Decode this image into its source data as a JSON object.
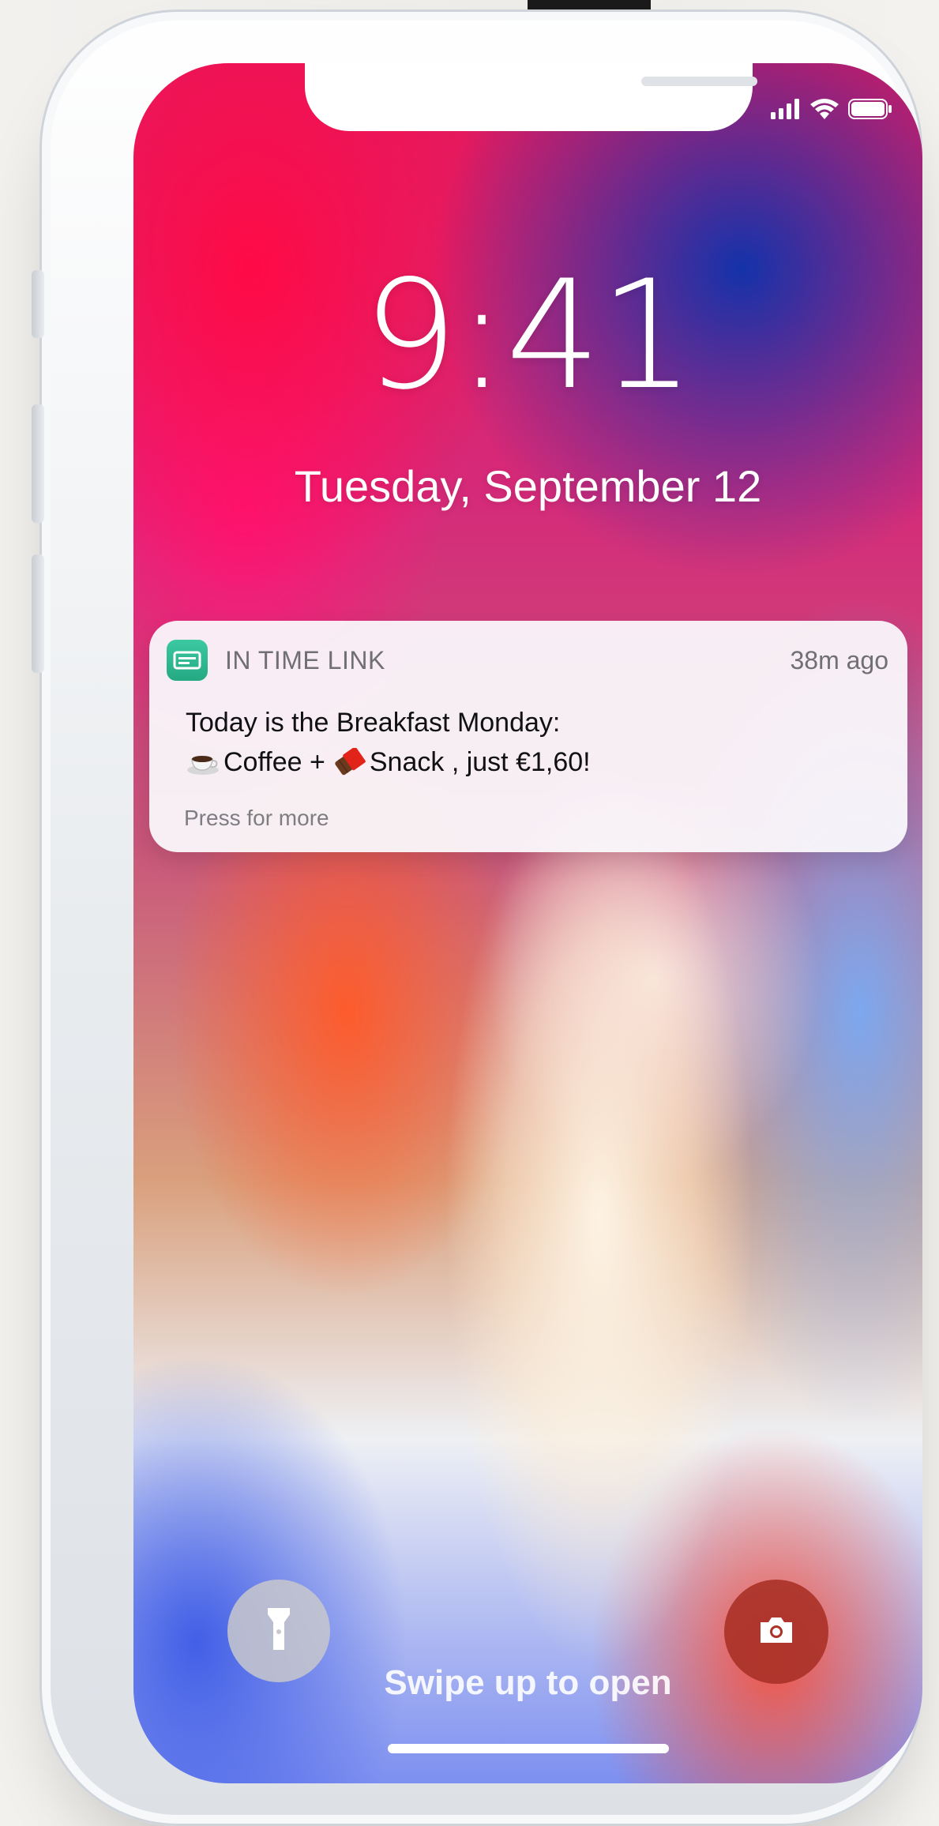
{
  "lock_screen": {
    "time": "9:41",
    "date": "Tuesday, September 12"
  },
  "notification": {
    "app_name": "IN TIME LINK",
    "timestamp": "38m ago",
    "line1": "Today is the Breakfast Monday:",
    "line2_part1": "Coffee +",
    "line2_part2": "Snack , just €1,60!",
    "more": "Press for more",
    "app_icon_color": "#2fbf95"
  },
  "bottom": {
    "swipe_text": "Swipe up to open"
  },
  "icons": {
    "status": [
      "cellular-signal-icon",
      "wifi-icon",
      "battery-icon"
    ],
    "notification_emoji": [
      "coffee-icon",
      "chocolate-icon"
    ],
    "lock_buttons": [
      "flashlight-icon",
      "camera-icon"
    ]
  }
}
